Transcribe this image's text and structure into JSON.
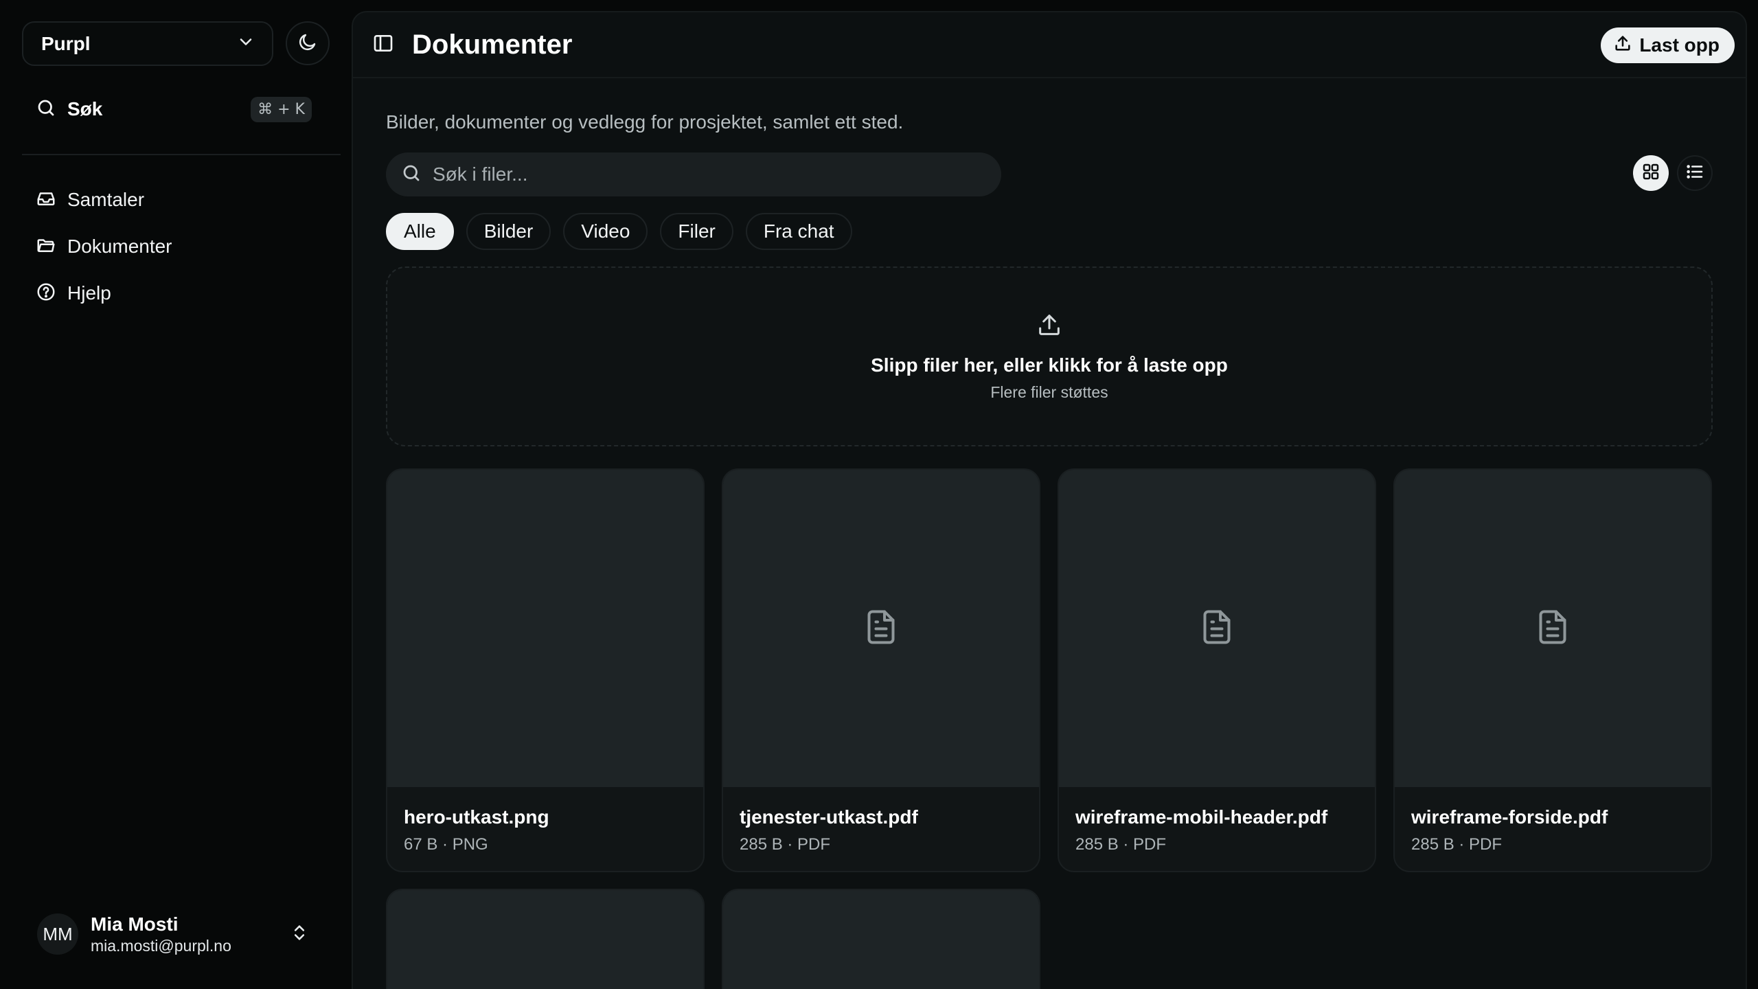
{
  "sidebar": {
    "workspace": "Purpl",
    "search": {
      "label": "Søk",
      "shortcut": "⌘ + K"
    },
    "nav": [
      {
        "label": "Samtaler",
        "icon": "inbox-icon"
      },
      {
        "label": "Dokumenter",
        "icon": "folder-icon"
      },
      {
        "label": "Hjelp",
        "icon": "help-circle-icon"
      }
    ],
    "user": {
      "initials": "MM",
      "name": "Mia Mosti",
      "email": "mia.mosti@purpl.no"
    }
  },
  "header": {
    "title": "Dokumenter",
    "upload_label": "Last opp"
  },
  "main": {
    "subtitle": "Bilder, dokumenter og vedlegg for prosjektet, samlet ett sted.",
    "search_placeholder": "Søk i filer...",
    "filters": [
      "Alle",
      "Bilder",
      "Video",
      "Filer",
      "Fra chat"
    ],
    "active_filter": "Alle",
    "view_mode": "grid",
    "dropzone": {
      "title": "Slipp filer her, eller klikk for å laste opp",
      "subtitle": "Flere filer støttes"
    },
    "files": [
      {
        "name": "hero-utkast.png",
        "info": "67 B · PNG",
        "icon": "none"
      },
      {
        "name": "tjenester-utkast.pdf",
        "info": "285 B · PDF",
        "icon": "file-text-icon"
      },
      {
        "name": "wireframe-mobil-header.pdf",
        "info": "285 B · PDF",
        "icon": "file-text-icon"
      },
      {
        "name": "wireframe-forside.pdf",
        "info": "285 B · PDF",
        "icon": "file-text-icon"
      }
    ]
  },
  "colors": {
    "background": "#060808",
    "panel": "#0c1011",
    "card": "#1e2426",
    "accent": "#eef1f2"
  }
}
